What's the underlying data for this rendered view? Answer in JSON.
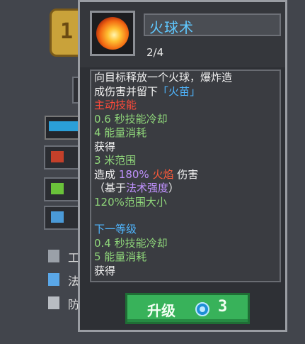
{
  "background": {
    "badge_digit": "1",
    "rows": [
      {
        "label": "工",
        "icon": "sword-icon"
      },
      {
        "label": "法",
        "icon": "wand-icon"
      },
      {
        "label": "防",
        "icon": "shield-icon"
      }
    ]
  },
  "tooltip": {
    "title": "火球术",
    "level": "2/4",
    "desc": {
      "l1": "向目标释放一个火球，爆炸造",
      "l2a": "成伤害并留下",
      "l2b": "「火苗」",
      "active": "主动技能",
      "cooldown": "0.6 秒技能冷却",
      "energy": "4 能量消耗",
      "gain": "获得",
      "range": "3 米范围",
      "dmg_a": "造成",
      "dmg_pct": "180%",
      "dmg_type": "火焰",
      "dmg_b": "伤害",
      "based_a": "（基于",
      "based_stat": "法术强度",
      "based_b": "）",
      "area": "120%范围大小",
      "next_level": "下一等级",
      "next_cooldown": "0.4 秒技能冷却",
      "next_energy": "5 能量消耗",
      "next_gain": "获得"
    },
    "upgrade": {
      "label": "升级",
      "cost": "3",
      "currency_icon": "orb-icon"
    }
  },
  "colors": {
    "title": "#5fc8ff",
    "active": "#ff4a3a",
    "value": "#8fd67a",
    "button": "#38b25a"
  }
}
